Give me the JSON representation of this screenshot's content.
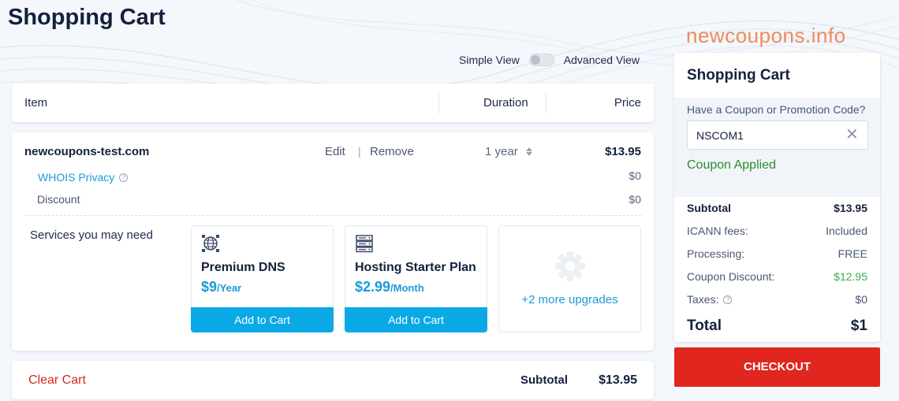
{
  "page": {
    "title": "Shopping Cart",
    "watermark": "newcoupons.info"
  },
  "view_toggle": {
    "simple_label": "Simple View",
    "advanced_label": "Advanced View",
    "mode": "simple"
  },
  "table_header": {
    "item": "Item",
    "duration": "Duration",
    "price": "Price"
  },
  "cart_item": {
    "domain": "newcoupons-test.com",
    "edit_label": "Edit",
    "separator": "|",
    "remove_label": "Remove",
    "duration": "1 year",
    "price": "$13.95",
    "addons": [
      {
        "label": "WHOIS Privacy",
        "price": "$0"
      },
      {
        "label": "Discount",
        "price": "$0"
      }
    ]
  },
  "services": {
    "heading": "Services you may need",
    "items": [
      {
        "name": "Premium DNS",
        "price": "$9",
        "period": "/Year",
        "icon": "globe-network-icon",
        "button": "Add to Cart"
      },
      {
        "name": "Hosting Starter Plan",
        "price": "$2.99",
        "period": "/Month",
        "icon": "server-icon",
        "button": "Add to Cart"
      }
    ],
    "more_label": "+2 more upgrades",
    "more_icon": "gear-icon"
  },
  "footer": {
    "clear_cart": "Clear Cart",
    "subtotal_label": "Subtotal",
    "subtotal_value": "$13.95"
  },
  "summary": {
    "title": "Shopping Cart",
    "coupon_prompt": "Have a Coupon or Promotion Code?",
    "coupon_code": "NSCOM1",
    "coupon_status": "Coupon Applied",
    "lines": [
      {
        "label": "Subtotal",
        "value": "$13.95"
      },
      {
        "label": "ICANN fees:",
        "value": "Included"
      },
      {
        "label": "Processing:",
        "value": "FREE"
      },
      {
        "label": "Coupon Discount:",
        "value": "$12.95"
      },
      {
        "label": "Taxes:",
        "value": "$0"
      }
    ],
    "total_label": "Total",
    "total_value": "$1",
    "checkout_label": "CHECKOUT"
  },
  "colors": {
    "accent_blue": "#0aa9e6",
    "link_blue": "#1a9ad6",
    "checkout_red": "#e0261e",
    "clear_red": "#d6291f",
    "success_green": "#2e8b2e",
    "discount_green": "#33b24a",
    "watermark_orange": "#f08a5d",
    "title_navy": "#14213d"
  }
}
